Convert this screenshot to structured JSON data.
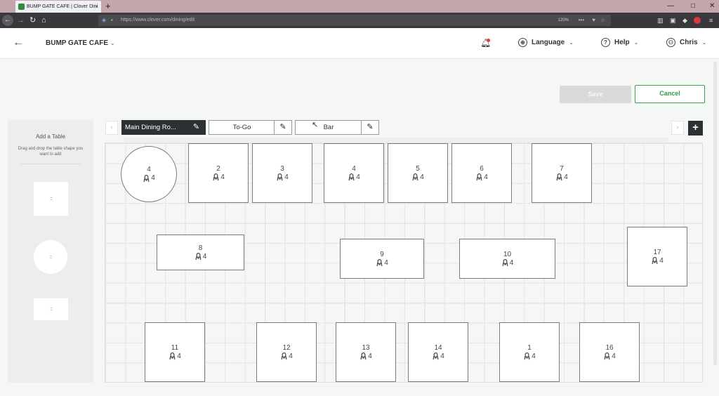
{
  "browser": {
    "tab_title": "BUMP GATE CAFE | Clover Dini",
    "tab_close": "×",
    "new_tab": "+",
    "url": "https://www.clover.com/dining/edit",
    "zoom": "120%",
    "url_dots": "•••"
  },
  "header": {
    "back": "←",
    "merchant": "BUMP GATE CAFE",
    "language": "Language",
    "help": "Help",
    "user": "Chris"
  },
  "actions": {
    "save": "Save",
    "cancel": "Cancel"
  },
  "sidebar": {
    "title": "Add a Table",
    "description": "Drag and drop the table shape you want to add",
    "handle": ":::"
  },
  "rooms": [
    {
      "label": "Main Dining Ro...",
      "active": true
    },
    {
      "label": "To-Go",
      "active": false
    },
    {
      "label": "Bar",
      "active": false
    }
  ],
  "add_room": "+",
  "tables": [
    {
      "number": "4",
      "seats": "4",
      "shape": "round"
    },
    {
      "number": "2",
      "seats": "4",
      "shape": "square"
    },
    {
      "number": "3",
      "seats": "4",
      "shape": "square"
    },
    {
      "number": "4",
      "seats": "4",
      "shape": "square"
    },
    {
      "number": "5",
      "seats": "4",
      "shape": "square"
    },
    {
      "number": "6",
      "seats": "4",
      "shape": "square"
    },
    {
      "number": "7",
      "seats": "4",
      "shape": "square"
    },
    {
      "number": "8",
      "seats": "4",
      "shape": "rect"
    },
    {
      "number": "9",
      "seats": "4",
      "shape": "rect"
    },
    {
      "number": "10",
      "seats": "4",
      "shape": "rect"
    },
    {
      "number": "17",
      "seats": "4",
      "shape": "square"
    },
    {
      "number": "11",
      "seats": "4",
      "shape": "square"
    },
    {
      "number": "12",
      "seats": "4",
      "shape": "square"
    },
    {
      "number": "13",
      "seats": "4",
      "shape": "square"
    },
    {
      "number": "14",
      "seats": "4",
      "shape": "square"
    },
    {
      "number": "1",
      "seats": "4",
      "shape": "square"
    },
    {
      "number": "16",
      "seats": "4",
      "shape": "square"
    }
  ]
}
